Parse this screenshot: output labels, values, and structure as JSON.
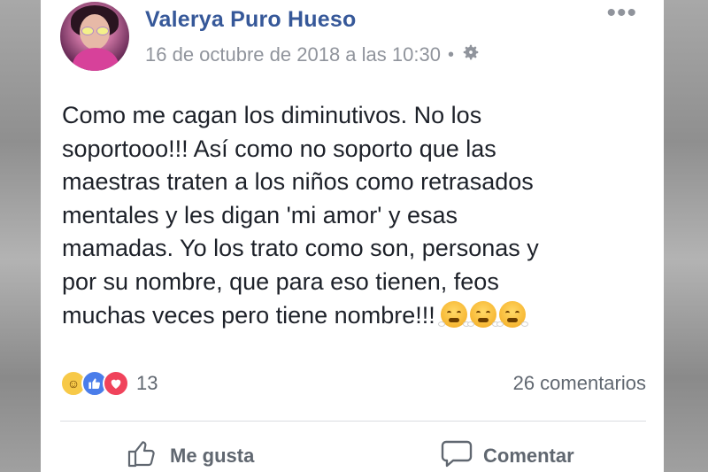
{
  "post": {
    "author": "Valerya Puro Hueso",
    "timestamp": "16 de octubre de 2018 a las 10:30",
    "separator": "•",
    "privacy_icon": "gear-icon",
    "more_label": "•••",
    "text": "Como me cagan los diminutivos. No los\nsoportooo!!! Así como no soporto que las\nmaestras traten a los niños como retrasados\nmentales y les digan 'mi amor' y esas\nmamadas. Yo los trato como son, personas y\npor su nombre, que para eso tienen, feos\nmuchas veces pero tiene nombre!!!",
    "trailing_emojis": [
      "angry-steam-emoji",
      "angry-steam-emoji",
      "angry-steam-emoji"
    ]
  },
  "engagement": {
    "reaction_icons": [
      "haha-icon",
      "like-icon",
      "love-icon"
    ],
    "reaction_count": "13",
    "comments": "26 comentarios"
  },
  "actions": {
    "like_label": "Me gusta",
    "comment_label": "Comentar"
  },
  "colors": {
    "author": "#365899",
    "meta": "#90949c",
    "body_text": "#1d2129",
    "like_blue": "#4a7dea",
    "love_red": "#f0435b"
  }
}
